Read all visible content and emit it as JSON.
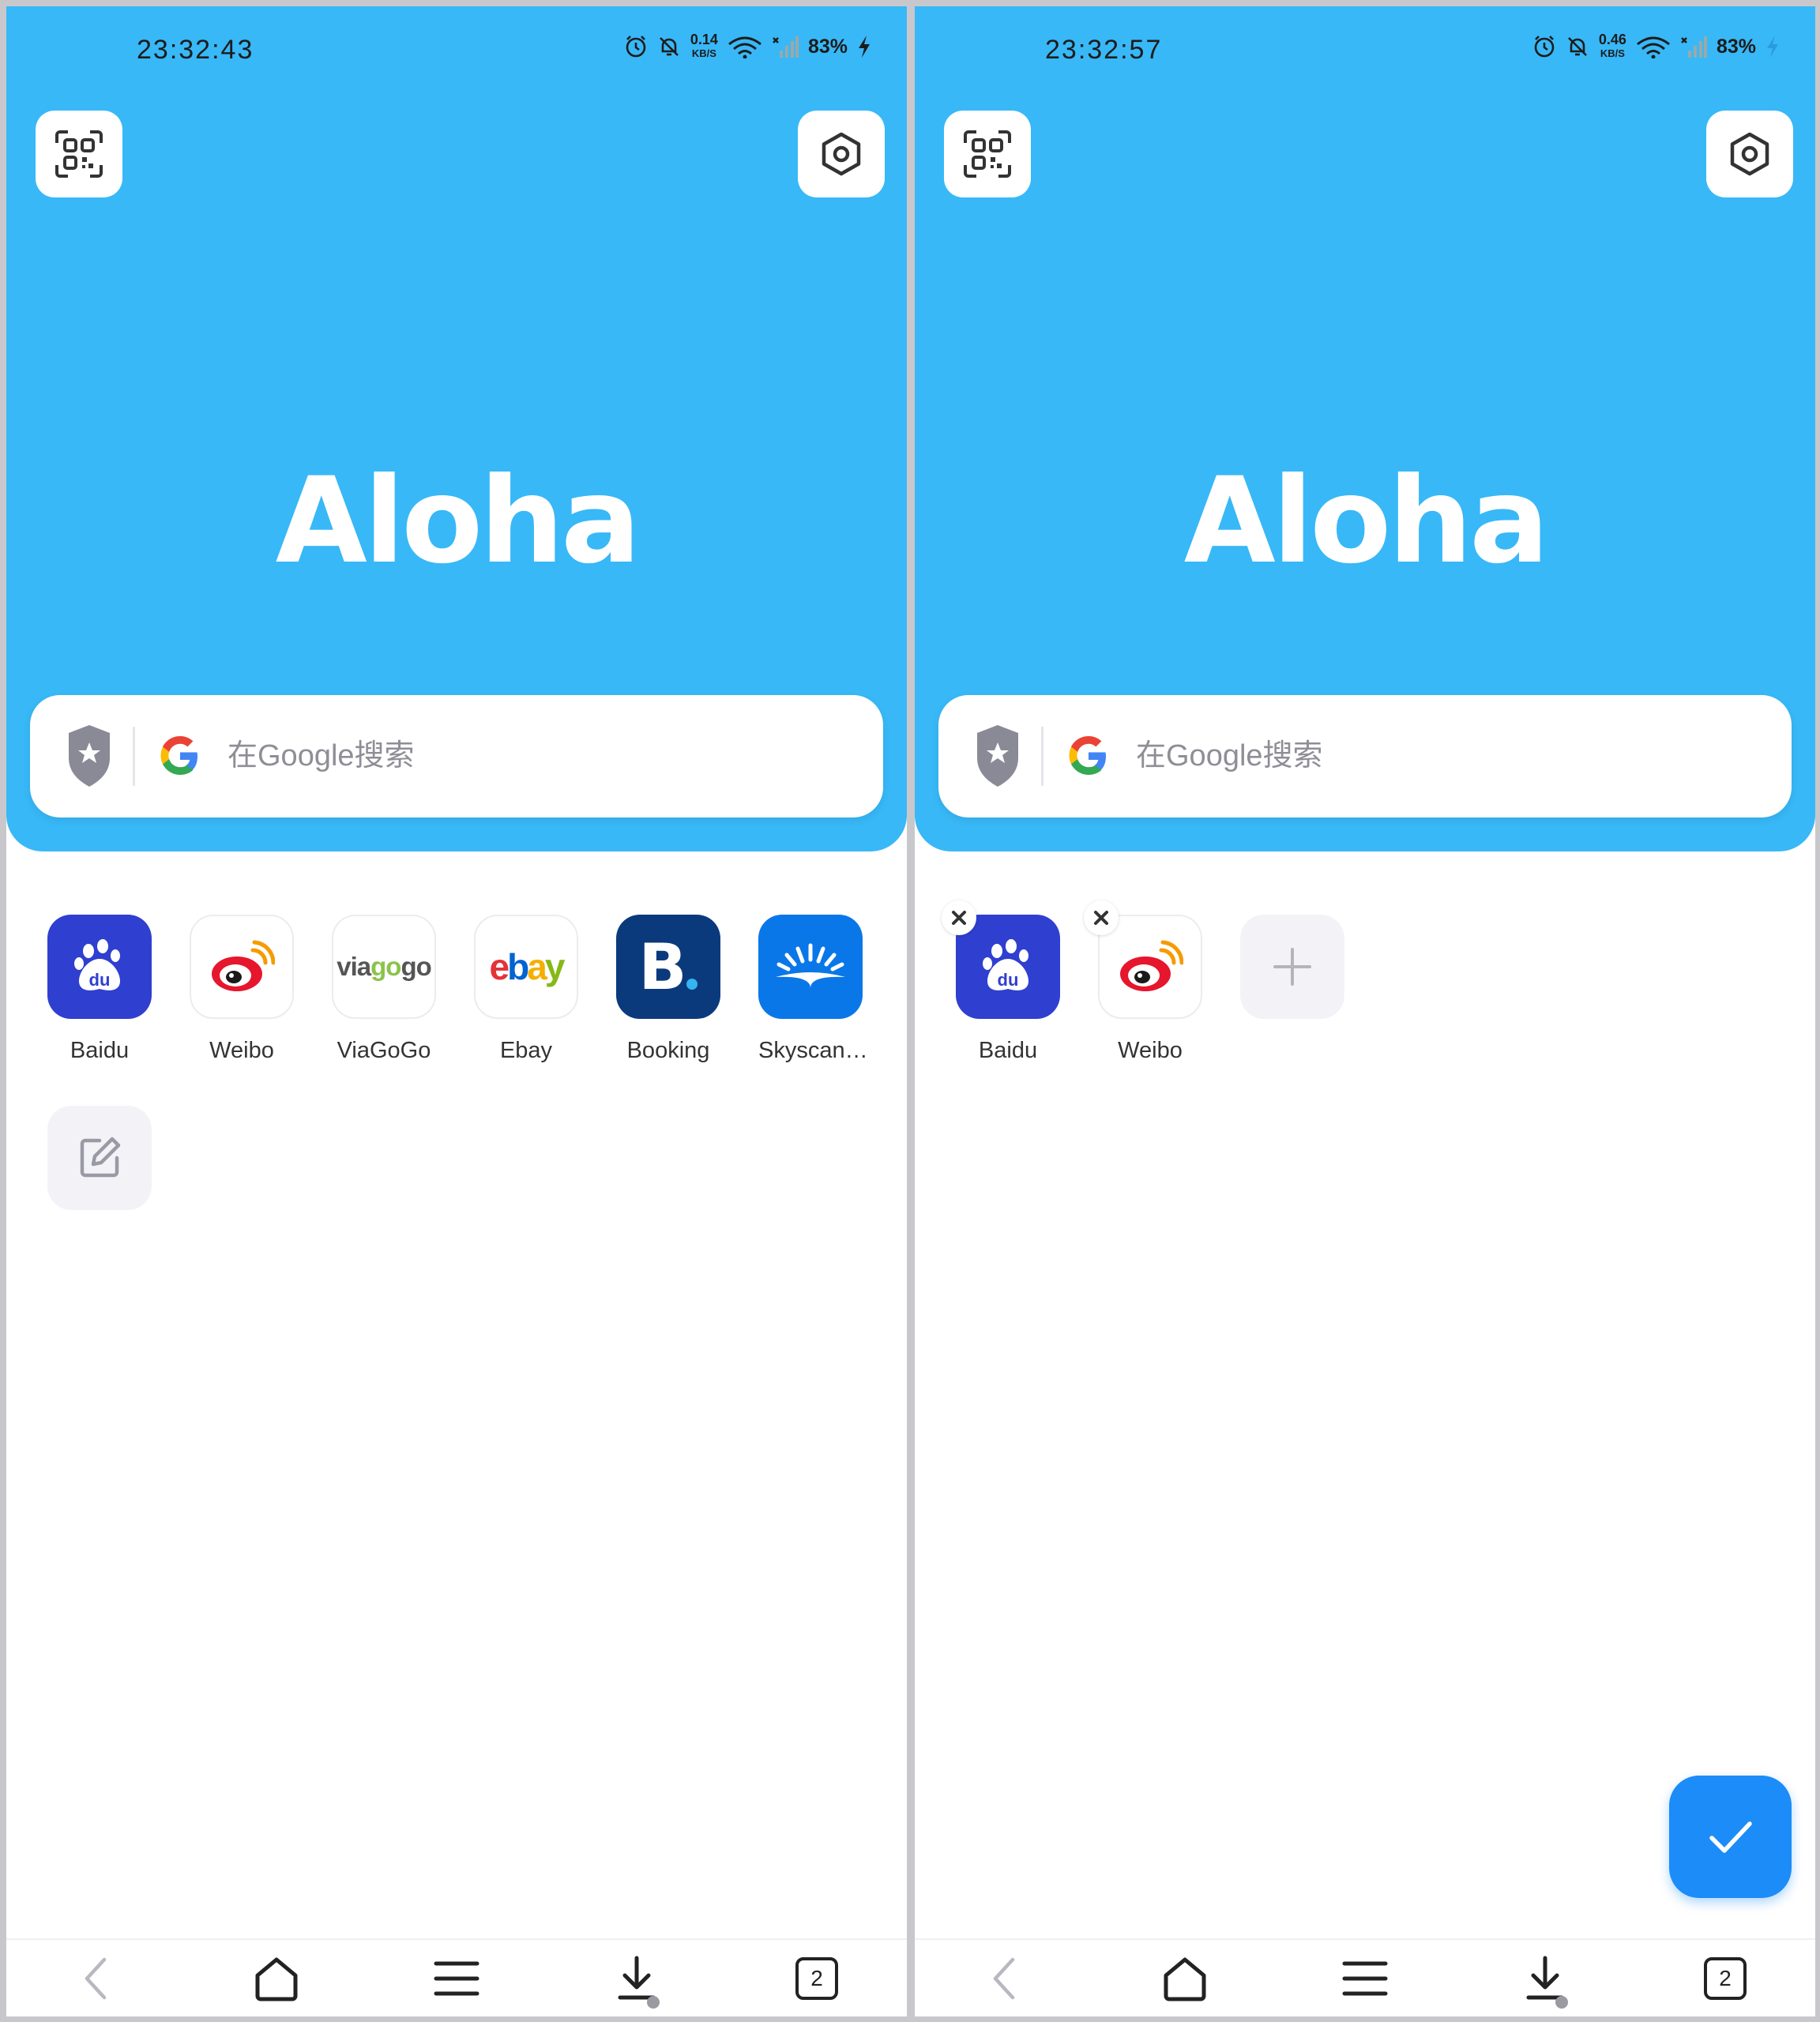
{
  "left_screen": {
    "status_bar": {
      "time": "23:32:43",
      "net_speed": "0.14",
      "net_unit": "KB/S",
      "battery": "83%"
    },
    "brand": "Aloha",
    "search": {
      "placeholder": "在Google搜索"
    },
    "speed_dial": [
      {
        "label": "Baidu",
        "icon": "baidu-paw-icon"
      },
      {
        "label": "Weibo",
        "icon": "weibo-eye-icon"
      },
      {
        "label": "ViaGoGo",
        "icon": "viagogo-logo",
        "logo_text": "viagogo"
      },
      {
        "label": "Ebay",
        "icon": "ebay-logo",
        "logo_text": "ebay"
      },
      {
        "label": "Booking",
        "icon": "booking-logo",
        "logo_text": "B."
      },
      {
        "label": "Skyscan…",
        "icon": "skyscanner-sunrise-icon"
      }
    ],
    "edit_tile": {
      "icon": "edit-icon"
    },
    "bottom_nav": {
      "tab_count": "2"
    }
  },
  "right_screen": {
    "status_bar": {
      "time": "23:32:57",
      "net_speed": "0.46",
      "net_unit": "KB/S",
      "battery": "83%"
    },
    "brand": "Aloha",
    "search": {
      "placeholder": "在Google搜索"
    },
    "speed_dial": [
      {
        "label": "Baidu",
        "icon": "baidu-paw-icon"
      },
      {
        "label": "Weibo",
        "icon": "weibo-eye-icon"
      }
    ],
    "add_tile": {
      "icon": "plus-icon"
    },
    "confirm": {
      "icon": "checkmark-icon"
    },
    "bottom_nav": {
      "tab_count": "2"
    }
  },
  "colors": {
    "hero_blue": "#38b8f7",
    "baidu_blue": "#2f3fd0",
    "booking_navy": "#0b3a7c",
    "skyscanner_blue": "#0a77e8",
    "confirm_blue": "#1c8cf8",
    "weibo_red": "#e6162d"
  }
}
